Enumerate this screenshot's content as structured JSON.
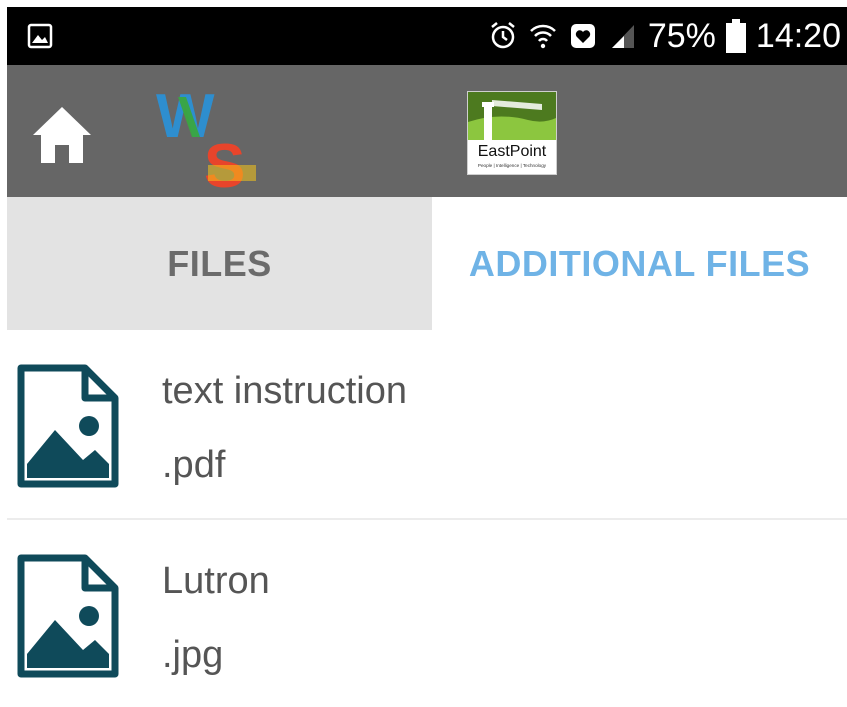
{
  "status_bar": {
    "battery_percent": "75%",
    "time": "14:20",
    "icons": [
      "image-notification-icon",
      "alarm-icon",
      "wifi-icon",
      "heart-notification-icon",
      "signal-icon",
      "battery-icon"
    ]
  },
  "app_bar": {
    "left_logo_letters": [
      "W",
      "S"
    ],
    "right_logo_text": "EastPoint",
    "right_logo_tagline": "People | Intelligence | Technology",
    "colors": {
      "background": "#666666",
      "w_blue": "#2e8ecf",
      "w_green": "#3aa640",
      "s_red": "#e8442b",
      "s_yellow": "#f5c518"
    }
  },
  "tabs": [
    {
      "label": "FILES",
      "selected": false
    },
    {
      "label": "ADDITIONAL FILES",
      "selected": true
    }
  ],
  "files": [
    {
      "name": "text instruction",
      "extension": ".pdf",
      "icon": "image-file-icon"
    },
    {
      "name": "Lutron",
      "extension": ".jpg",
      "icon": "image-file-icon"
    }
  ],
  "theme": {
    "accent": "#6fb3e6",
    "icon_color": "#0f4a5a"
  }
}
